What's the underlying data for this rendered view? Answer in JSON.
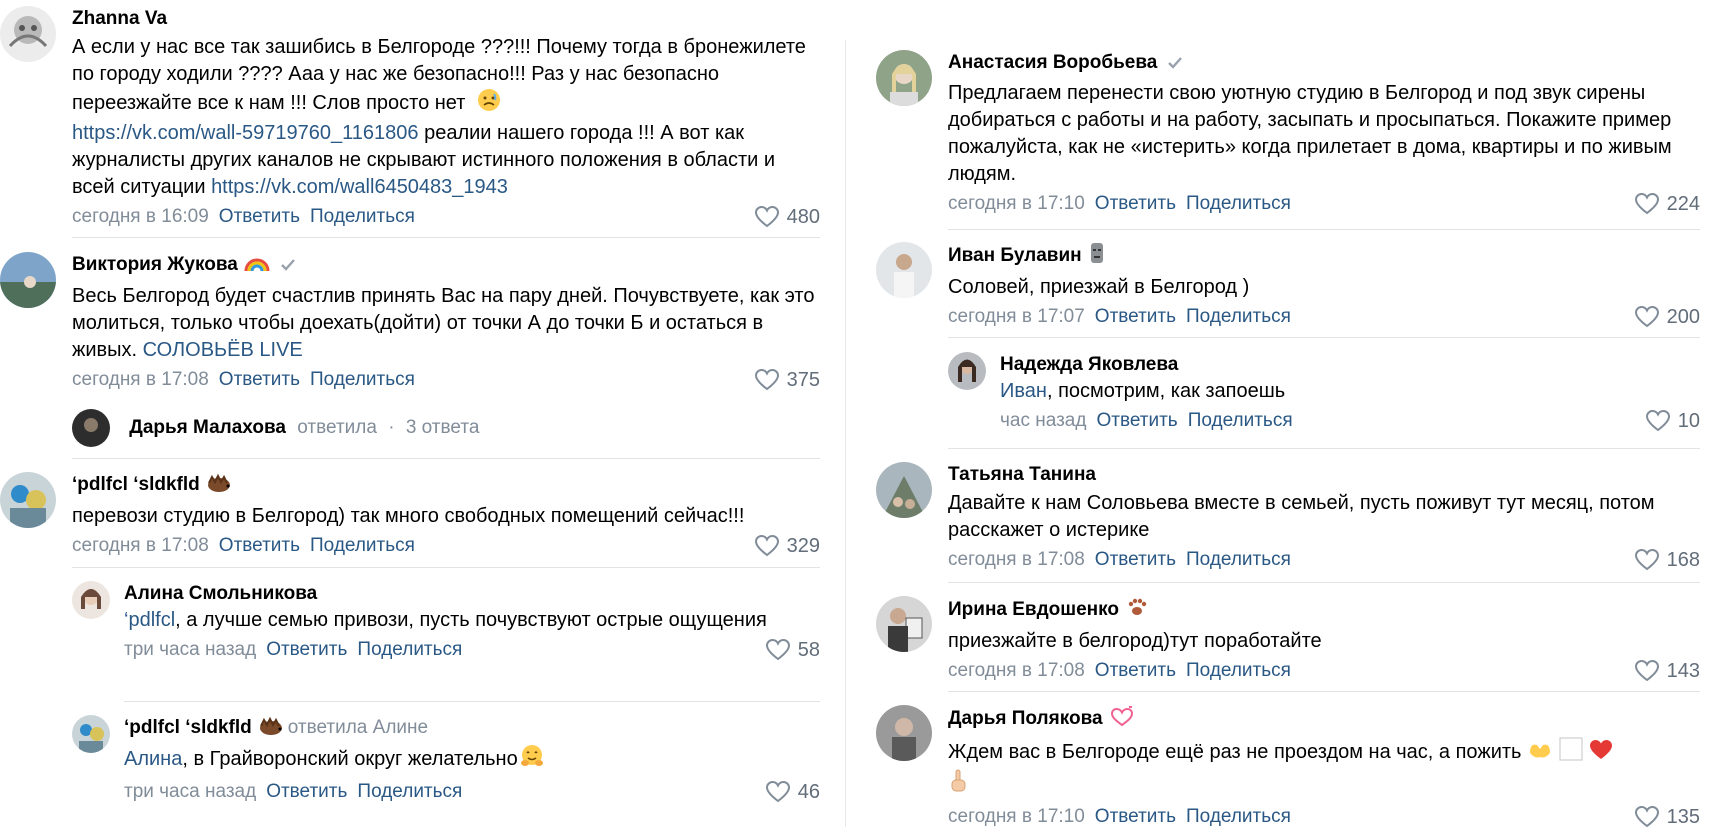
{
  "actions": {
    "reply": "Ответить",
    "share": "Поделиться"
  },
  "colors": {
    "link": "#2a5885",
    "meta": "#818c99",
    "divider": "#e1e3e6"
  },
  "left": {
    "c1": {
      "author": "Zhanna Va",
      "text_a": "А если у нас все так зашибись в Белгороде ???!!! Почему тогда в бронежилете по городу ходили ???? Ааа у нас же безопасно!!! Раз у нас безопасно переезжайте все к нам !!! Слов просто нет ",
      "link1": "https://vk.com/wall-59719760_1161806",
      "text_b": " реалии нашего города !!! А вот как журналисты других каналов не скрывают истинного положения в области и всей ситуации ",
      "link2": "https://vk.com/wall6450483_1943",
      "time": "сегодня в 16:09",
      "likes": "480"
    },
    "c2": {
      "author": "Виктория Жукова",
      "text": "Весь Белгород будет счастлив принять Вас на пару дней. Почувствуете, как это молиться, только чтобы доехать(дойти) от точки А до точки Б и остаться в живых. ",
      "link": "СОЛОВЬЁВ LIVE",
      "time": "сегодня в 17:08",
      "likes": "375"
    },
    "thread": {
      "name": "Дарья Малахова",
      "replied": "ответила",
      "dot": "·",
      "count": "3 ответа"
    },
    "c3": {
      "author": "‘pdlfcl ‘sldkfld",
      "text": "перевози студию в Белгород) так много свободных помещений сейчас!!!",
      "time": "сегодня в 17:08",
      "likes": "329"
    },
    "r1": {
      "author": "Алина Смольникова",
      "mention": "‘pdlfcl",
      "text": ", а лучше семью привози, пусть почувствуют острые ощущения",
      "time": "три часа назад",
      "likes": "58"
    },
    "r2": {
      "author": "‘pdlfcl ‘sldkfld",
      "meta": "ответила Алине",
      "mention": "Алина",
      "text": ", в Грайворонский округ желательно",
      "time": "три часа назад",
      "likes": "46"
    }
  },
  "right": {
    "c1": {
      "author": "Анастасия Воробьева",
      "text": "Предлагаем перенести свою уютную студию в Белгород и под звук сирены добираться с работы и на работу, засыпать и просыпаться. Покажите пример пожалуйста, как не «истерить» когда прилетает в дома, квартиры и по живым людям.",
      "time": "сегодня в 17:10",
      "likes": "224"
    },
    "c2": {
      "author": "Иван Булавин",
      "text": "Соловей, приезжай в Белгород )",
      "time": "сегодня в 17:07",
      "likes": "200"
    },
    "r1": {
      "author": "Надежда Яковлева",
      "mention": "Иван",
      "text": ", посмотрим, как запоешь",
      "time": "час назад",
      "likes": "10"
    },
    "c3": {
      "author": "Татьяна Танина",
      "text": "Давайте к нам Соловьева вместе в семьей, пусть поживут тут месяц, потом расскажет о истерике",
      "time": "сегодня в 17:08",
      "likes": "168"
    },
    "c4": {
      "author": "Ирина Евдошенко",
      "text": "приезжайте в белгород)тут поработайте",
      "time": "сегодня в 17:08",
      "likes": "143"
    },
    "c5": {
      "author": "Дарья Полякова",
      "text": "Ждем вас в Белгороде ещё раз не проездом на час, а пожить",
      "time": "сегодня в 17:10",
      "likes": "135"
    }
  }
}
